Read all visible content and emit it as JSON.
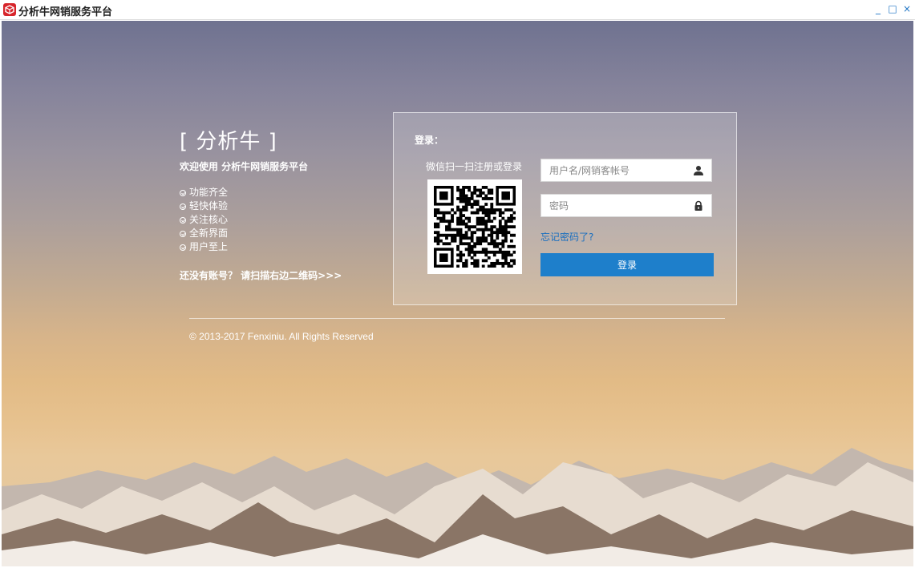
{
  "window": {
    "title": "分析牛网销服务平台",
    "controls": {
      "minimize": "_",
      "maximize": "□",
      "close": "×"
    }
  },
  "intro": {
    "brand": "[ 分析牛 ]",
    "welcome": "欢迎使用 分析牛网销服务平台",
    "features": [
      "功能齐全",
      "轻快体验",
      "关注核心",
      "全新界面",
      "用户至上"
    ],
    "signup_hint": "还没有账号？ 请扫描右边二维码>>>"
  },
  "login": {
    "title": "登录：",
    "qr_caption": "微信扫一扫注册或登录",
    "username_placeholder": "用户名/网销客帐号",
    "password_placeholder": "密码",
    "forgot_link": "忘记密码了?",
    "submit_label": "登录"
  },
  "footer": {
    "copyright": "© 2013-2017 Fenxiniu. All Rights Reserved"
  },
  "icons": {
    "app": "cube-logo-icon",
    "username": "user-icon",
    "password": "lock-icon",
    "feature_bullet": "check-circle-icon"
  },
  "colors": {
    "accent": "#1e7fcb",
    "link": "#1a6fbf",
    "window_controls": "#1c73c4",
    "app_icon": "#d7252b"
  }
}
